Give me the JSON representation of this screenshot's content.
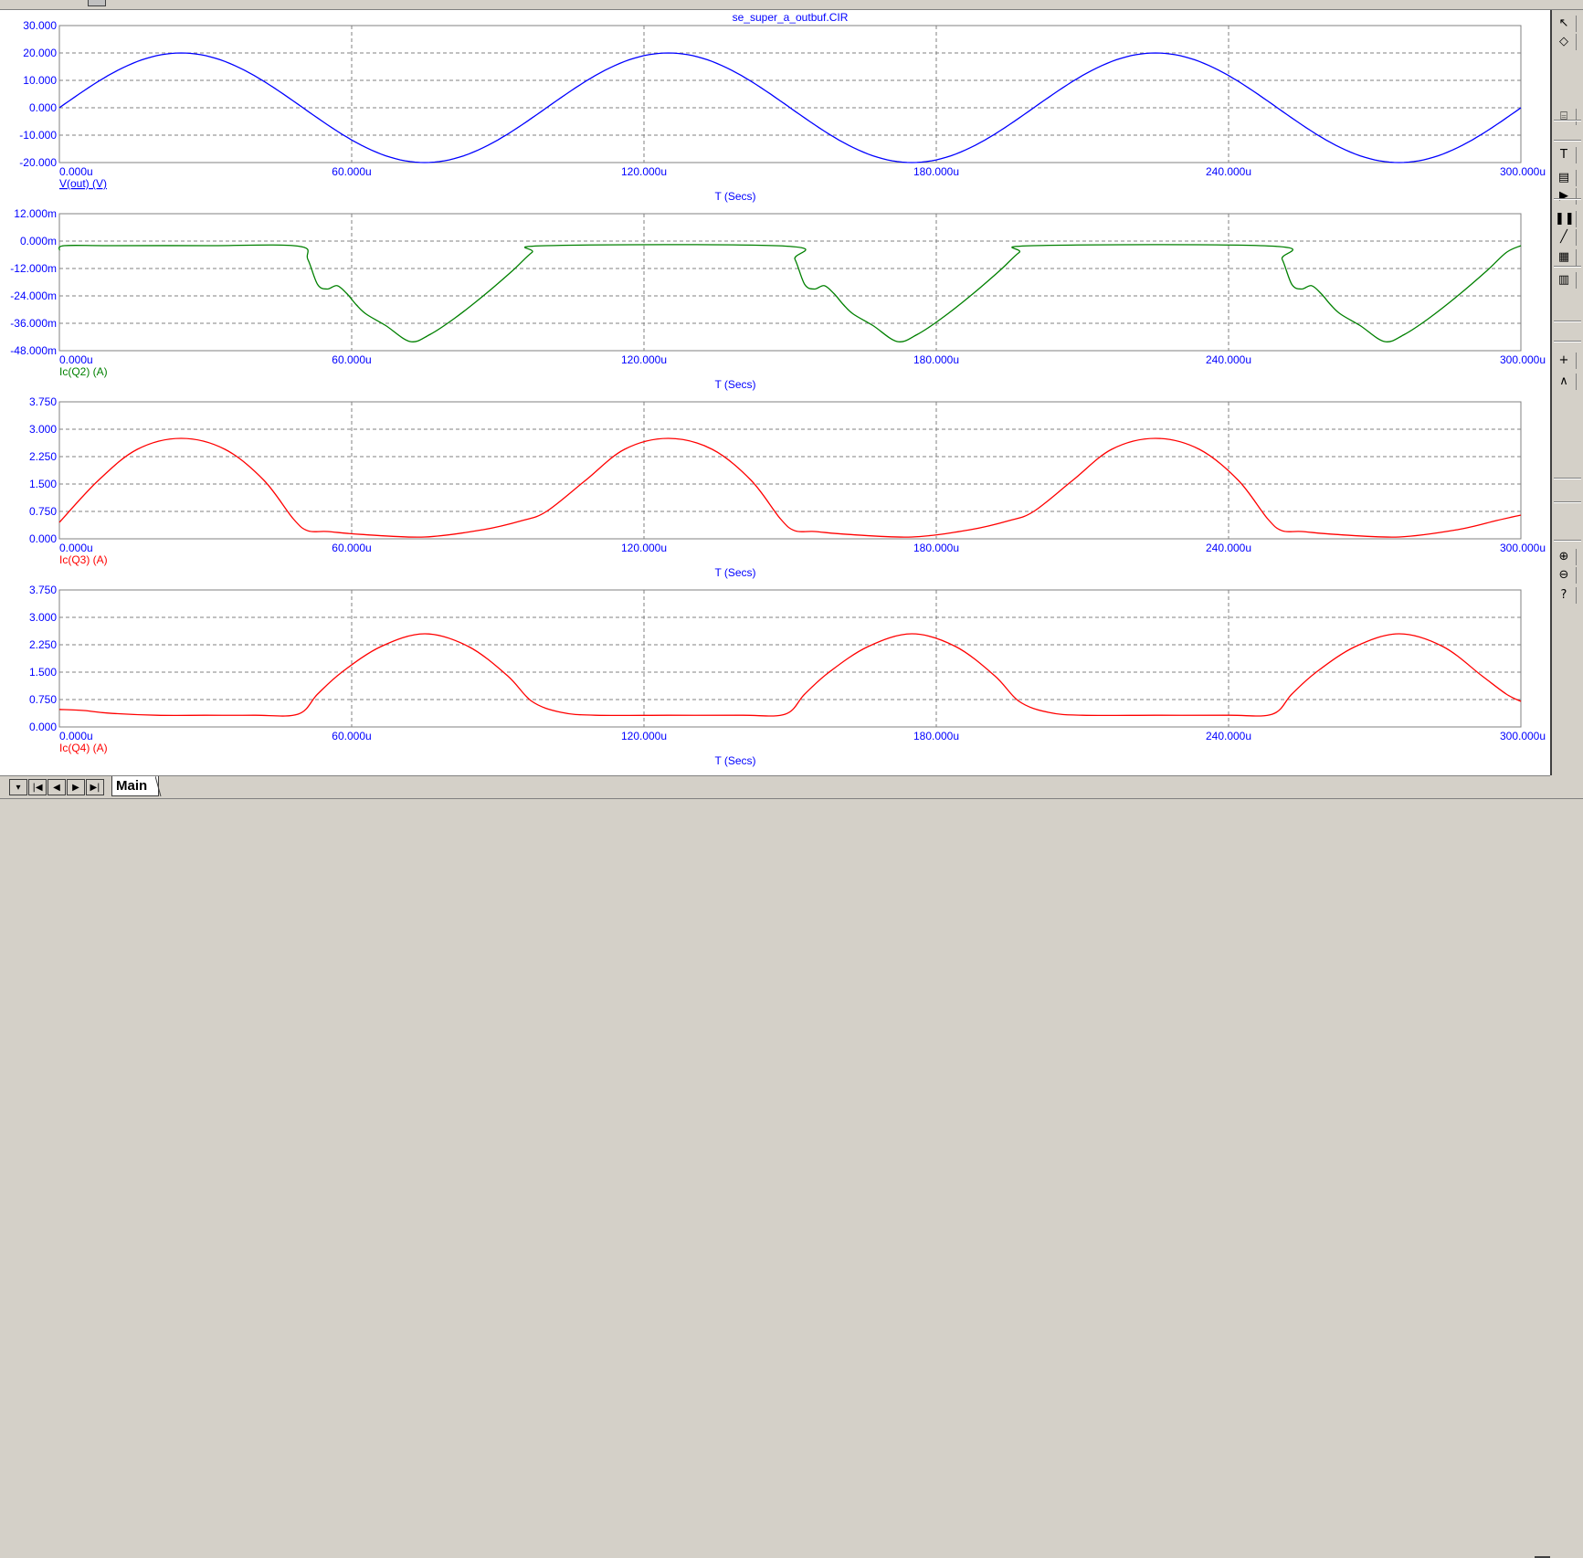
{
  "window": {
    "title": "se_super_a_outbuf.CIR"
  },
  "colors": {
    "axis_text": "#0000ff",
    "grid": "#808080",
    "v_out": "#0000ff",
    "ic_q2": "#008000",
    "ic_q3": "#ff0000",
    "ic_q4": "#ff0000"
  },
  "tabs": {
    "sheet_label": "Main"
  },
  "tab_nav": [
    "dropdown-icon",
    "first-icon",
    "prev-icon",
    "next-icon",
    "last-icon"
  ],
  "toolbar_icons": [
    "select-arrow-icon",
    "shape-icon",
    "graph-icon",
    "text-icon",
    "properties-icon",
    "run-icon",
    "pause-icon",
    "line-icon",
    "grid-icon",
    "table-icon",
    "cursor-icon",
    "peak-icon",
    "zoom-in-icon",
    "zoom-out-icon",
    "help-icon"
  ],
  "chart_data": [
    {
      "type": "line",
      "title": "se_super_a_outbuf.CIR",
      "xlabel": "T (Secs)",
      "xlim": [
        0,
        300
      ],
      "xticks": [
        "0.000u",
        "60.000u",
        "120.000u",
        "180.000u",
        "240.000u",
        "300.000u"
      ],
      "ylim": [
        -20,
        30
      ],
      "yticks": [
        "30.000",
        "20.000",
        "10.000",
        "0.000",
        "-10.000",
        "-20.000"
      ],
      "grid": true,
      "series": [
        {
          "name": "V(out) (V)",
          "color": "#0000ff",
          "x": [
            0,
            12.5,
            25,
            37.5,
            50,
            62.5,
            75,
            87.5,
            100,
            112.5,
            125,
            137.5,
            150,
            162.5,
            175,
            187.5,
            200,
            212.5,
            225,
            237.5,
            250,
            262.5,
            275,
            287.5,
            300
          ],
          "y": [
            0,
            14.1,
            20,
            14.1,
            0,
            -14.1,
            -20,
            -14.1,
            0,
            14.1,
            20,
            14.1,
            0,
            -14.1,
            -20,
            -14.1,
            0,
            14.1,
            20,
            14.1,
            0,
            -14.1,
            -20,
            -14.1,
            0
          ]
        }
      ]
    },
    {
      "type": "line",
      "xlabel": "T (Secs)",
      "xlim": [
        0,
        300
      ],
      "xticks": [
        "0.000u",
        "60.000u",
        "120.000u",
        "180.000u",
        "240.000u",
        "300.000u"
      ],
      "ylim": [
        -48,
        12
      ],
      "yticks": [
        "12.000m",
        "0.000m",
        "-12.000m",
        "-24.000m",
        "-36.000m",
        "-48.000m"
      ],
      "grid": true,
      "series": [
        {
          "name": "Ic(Q2) (A)",
          "color": "#008000",
          "x": [
            0,
            1,
            10,
            30,
            49,
            51,
            53,
            55,
            57,
            59,
            61,
            63,
            67,
            72,
            76,
            81,
            87,
            93,
            97,
            100,
            149,
            151,
            153,
            155,
            157,
            159,
            161,
            163,
            167,
            172,
            176,
            181,
            187,
            193,
            197,
            200,
            249,
            251,
            253,
            255,
            257,
            259,
            261,
            263,
            267,
            272,
            276,
            281,
            287,
            293,
            297,
            300
          ],
          "y": [
            -4,
            -2,
            -2,
            -2,
            -2.2,
            -8,
            -19,
            -21,
            -19.5,
            -23,
            -28,
            -32,
            -37,
            -44,
            -41,
            -34,
            -24,
            -13,
            -5,
            -2,
            -2.2,
            -8,
            -19,
            -21,
            -19.5,
            -23,
            -28,
            -32,
            -37,
            -44,
            -41,
            -34,
            -24,
            -13,
            -5,
            -2,
            -2.2,
            -8,
            -19,
            -21,
            -19.5,
            -23,
            -28,
            -32,
            -37,
            -44,
            -41,
            -34,
            -24,
            -13,
            -5,
            -2
          ]
        }
      ]
    },
    {
      "type": "line",
      "xlabel": "T (Secs)",
      "xlim": [
        0,
        300
      ],
      "xticks": [
        "0.000u",
        "60.000u",
        "120.000u",
        "180.000u",
        "240.000u",
        "300.000u"
      ],
      "ylim": [
        0,
        3.75
      ],
      "yticks": [
        "3.750",
        "3.000",
        "2.250",
        "1.500",
        "0.750",
        "0.000"
      ],
      "grid": true,
      "series": [
        {
          "name": "Ic(Q3) (A)",
          "color": "#ff0000",
          "x": [
            0,
            8,
            16,
            25,
            34,
            42,
            48,
            51,
            55,
            62,
            75,
            87,
            95,
            100,
            108,
            116,
            125,
            134,
            142,
            148,
            151,
            155,
            162,
            175,
            187,
            195,
            200,
            208,
            216,
            225,
            234,
            242,
            248,
            251,
            255,
            262,
            275,
            287,
            295,
            300
          ],
          "y": [
            0.45,
            1.6,
            2.45,
            2.75,
            2.45,
            1.6,
            0.55,
            0.22,
            0.2,
            0.12,
            0.05,
            0.25,
            0.5,
            0.75,
            1.6,
            2.45,
            2.75,
            2.45,
            1.6,
            0.55,
            0.22,
            0.2,
            0.12,
            0.05,
            0.25,
            0.5,
            0.75,
            1.6,
            2.45,
            2.75,
            2.45,
            1.6,
            0.55,
            0.22,
            0.2,
            0.12,
            0.05,
            0.25,
            0.5,
            0.65
          ]
        }
      ]
    },
    {
      "type": "line",
      "xlabel": "T (Secs)",
      "xlim": [
        0,
        300
      ],
      "xticks": [
        "0.000u",
        "60.000u",
        "120.000u",
        "180.000u",
        "240.000u",
        "300.000u"
      ],
      "ylim": [
        0,
        3.75
      ],
      "yticks": [
        "3.750",
        "3.000",
        "2.250",
        "1.500",
        "0.750",
        "0.000"
      ],
      "grid": true,
      "series": [
        {
          "name": "Ic(Q4) (A)",
          "color": "#ff0000",
          "x": [
            0,
            5,
            10,
            20,
            30,
            40,
            49,
            53,
            58,
            66,
            75,
            84,
            92,
            97,
            103,
            110,
            125,
            140,
            149,
            153,
            158,
            166,
            175,
            184,
            192,
            197,
            203,
            210,
            225,
            240,
            249,
            253,
            258,
            266,
            275,
            284,
            292,
            297,
            300
          ],
          "y": [
            0.48,
            0.45,
            0.38,
            0.32,
            0.32,
            0.32,
            0.35,
            0.9,
            1.5,
            2.2,
            2.55,
            2.2,
            1.4,
            0.7,
            0.4,
            0.32,
            0.32,
            0.32,
            0.35,
            0.9,
            1.5,
            2.2,
            2.55,
            2.2,
            1.4,
            0.7,
            0.4,
            0.32,
            0.32,
            0.32,
            0.35,
            0.9,
            1.5,
            2.2,
            2.55,
            2.2,
            1.4,
            0.9,
            0.7
          ]
        }
      ]
    }
  ]
}
